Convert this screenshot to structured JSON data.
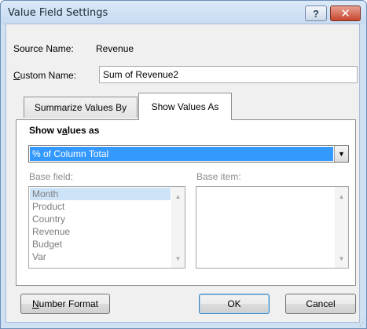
{
  "window": {
    "title": "Value Field Settings",
    "help_glyph": "?",
    "close_glyph": "✕"
  },
  "source": {
    "label": "Source Name:",
    "value": "Revenue"
  },
  "custom_name": {
    "label_first": "C",
    "label_rest": "ustom Name:",
    "value": "Sum of Revenue2"
  },
  "tabs": [
    {
      "label": "Summarize Values By",
      "active": false
    },
    {
      "label": "Show Values As",
      "active": true
    }
  ],
  "show_values_as": {
    "heading_pre": "Show v",
    "heading_ul": "a",
    "heading_post": "lues as",
    "selected": "% of Column Total"
  },
  "base_field": {
    "label": "Base field:",
    "items": [
      "Month",
      "Product",
      "Country",
      "Revenue",
      "Budget",
      "Var"
    ],
    "selected_index": 0
  },
  "base_item": {
    "label": "Base item:",
    "items": []
  },
  "buttons": {
    "number_format_first": "N",
    "number_format_rest": "umber Format",
    "ok": "OK",
    "cancel": "Cancel"
  },
  "icons": {
    "dropdown_arrow": "▼",
    "scroll_up": "▲",
    "scroll_down": "▼",
    "resize_grip": "⋰"
  }
}
